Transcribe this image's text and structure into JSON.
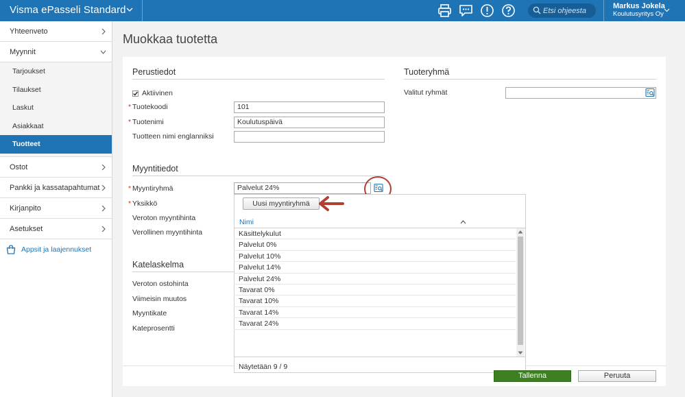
{
  "app": {
    "brand": "Visma ePasseli Standard",
    "search_placeholder": "Etsi ohjeesta",
    "user_name": "Markus Jokela",
    "user_company": "Koulutusyritys Oy"
  },
  "toolbar_icons": [
    "printer-icon",
    "chat-icon",
    "alert-icon",
    "help-icon",
    "search-icon"
  ],
  "sidebar": {
    "items": [
      {
        "label": "Yhteenveto"
      },
      {
        "label": "Myynnit"
      },
      {
        "label": "Ostot"
      },
      {
        "label": "Pankki ja kassatapahtumat"
      },
      {
        "label": "Kirjanpito"
      },
      {
        "label": "Asetukset"
      }
    ],
    "sub_items": [
      {
        "label": "Tarjoukset"
      },
      {
        "label": "Tilaukset"
      },
      {
        "label": "Laskut"
      },
      {
        "label": "Asiakkaat"
      },
      {
        "label": "Tuotteet"
      }
    ],
    "active_sub": "Tuotteet",
    "apps_label": "Appsit ja laajennukset"
  },
  "page": {
    "title": "Muokkaa tuotetta"
  },
  "basic": {
    "title": "Perustiedot",
    "active_label": "Aktiivinen",
    "active_checked": true,
    "code_label": "Tuotekoodi",
    "code_value": "101",
    "name_label": "Tuotenimi",
    "name_value": "Koulutuspäivä",
    "english_label": "Tuotteen nimi englanniksi",
    "english_value": ""
  },
  "group": {
    "title": "Tuoteryhmä",
    "selected_label": "Valitut ryhmät",
    "selected_value": ""
  },
  "sales": {
    "title": "Myyntitiedot",
    "group_label": "Myyntiryhmä",
    "group_value": "Palvelut 24%",
    "unit_label": "Yksikkö",
    "net_price_label": "Veroton myyntihinta",
    "gross_price_label": "Verollinen myyntihinta"
  },
  "margin": {
    "title": "Katelaskelma",
    "purchase_label": "Veroton ostohinta",
    "changed_label": "Viimeisin muutos",
    "account_label": "Myyntikate",
    "percent_label": "Kateprosentti"
  },
  "dropdown": {
    "new_button": "Uusi myyntiryhmä",
    "column_header": "Nimi",
    "rows": [
      "Käsittelykulut",
      "Palvelut 0%",
      "Palvelut 10%",
      "Palvelut 14%",
      "Palvelut 24%",
      "Tavarat 0%",
      "Tavarat 10%",
      "Tavarat 14%",
      "Tavarat 24%"
    ],
    "count": "Näytetään 9 / 9"
  },
  "actions": {
    "save": "Tallenna",
    "cancel": "Peruuta"
  },
  "colors": {
    "brand_blue": "#1f74b6",
    "save_green": "#3e7f22",
    "annotation_red": "#b04033",
    "required_red": "#d0312d"
  }
}
